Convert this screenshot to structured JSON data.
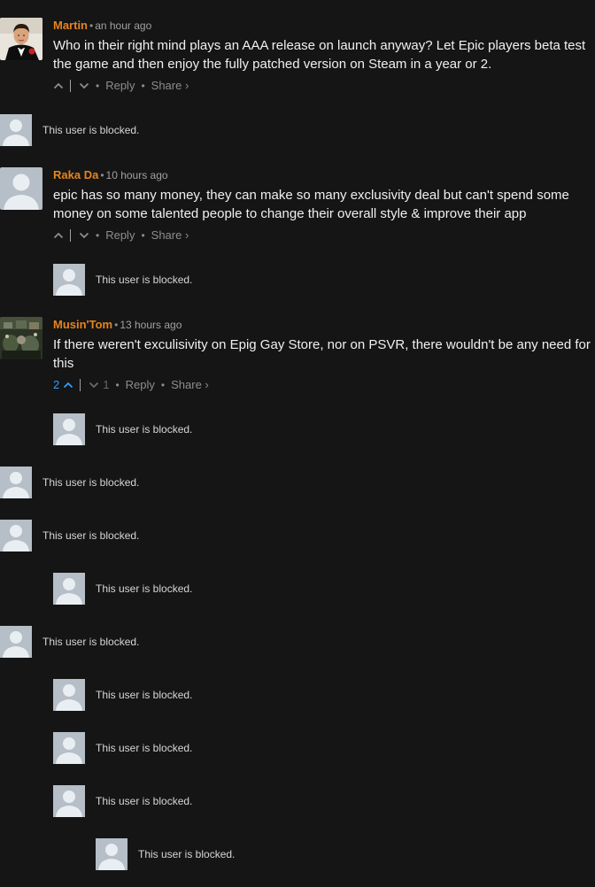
{
  "comments": [
    {
      "author": "Martin",
      "time": "an hour ago",
      "lines": [
        "Who in their right mind plays an AAA release on launch anyway? Let Epic players beta test",
        "the game and then enjoy the fully patched version on Steam in a year or 2."
      ],
      "reply_label": "Reply",
      "share_label": "Share ›"
    },
    {
      "author": "Raka Da",
      "time": "10 hours ago",
      "lines": [
        "epic has so many money, they can make so many exclusivity deal but can't spend some",
        "money on some talented people to change their overall style & improve their app"
      ],
      "reply_label": "Reply",
      "share_label": "Share ›"
    },
    {
      "author": "Musin'Tom",
      "time": "13 hours ago",
      "lines": [
        "If there weren't exculisivity on Epig Gay Store, nor on PSVR, there wouldn't be any need for",
        "this"
      ],
      "upvotes": "2",
      "downvotes": "1",
      "reply_label": "Reply",
      "share_label": "Share ›"
    }
  ],
  "blocked_text": "This user is blocked.",
  "blocked_count": 12,
  "colors": {
    "background": "#151515",
    "author": "#e5841f",
    "upvote_active": "#2e9fff",
    "muted": "#8d8d8d",
    "blocked_avatar": "#b6bec7"
  },
  "icons": [
    "upvote-chevron-icon",
    "downvote-chevron-icon",
    "default-avatar-icon"
  ]
}
